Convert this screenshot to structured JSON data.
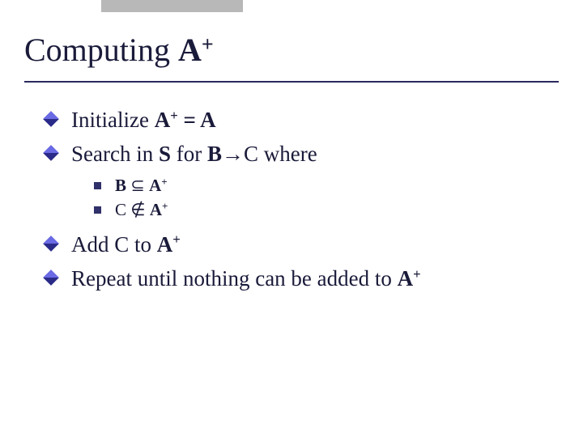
{
  "title": {
    "pre": "Computing ",
    "sym": "A",
    "sup": "+"
  },
  "bullets": {
    "b1": {
      "t1": "Initialize ",
      "sym": "A",
      "sup": "+",
      "t2": " = A"
    },
    "b2": {
      "t1": "Search in ",
      "s": "S",
      "t2": " for ",
      "B": "B",
      "arrow": "→",
      "t3": "C where"
    },
    "sub1": {
      "B": "B",
      "rel": " ⊆ ",
      "A": "A",
      "sup": "+"
    },
    "sub2": {
      "C": "C",
      "rel": " ∉ ",
      "A": "A",
      "sup": "+"
    },
    "b3": {
      "t1": "Add C to ",
      "A": "A",
      "sup": "+"
    },
    "b4": {
      "t1": "Repeat until nothing can be added to ",
      "A": "A",
      "sup": "+"
    }
  }
}
